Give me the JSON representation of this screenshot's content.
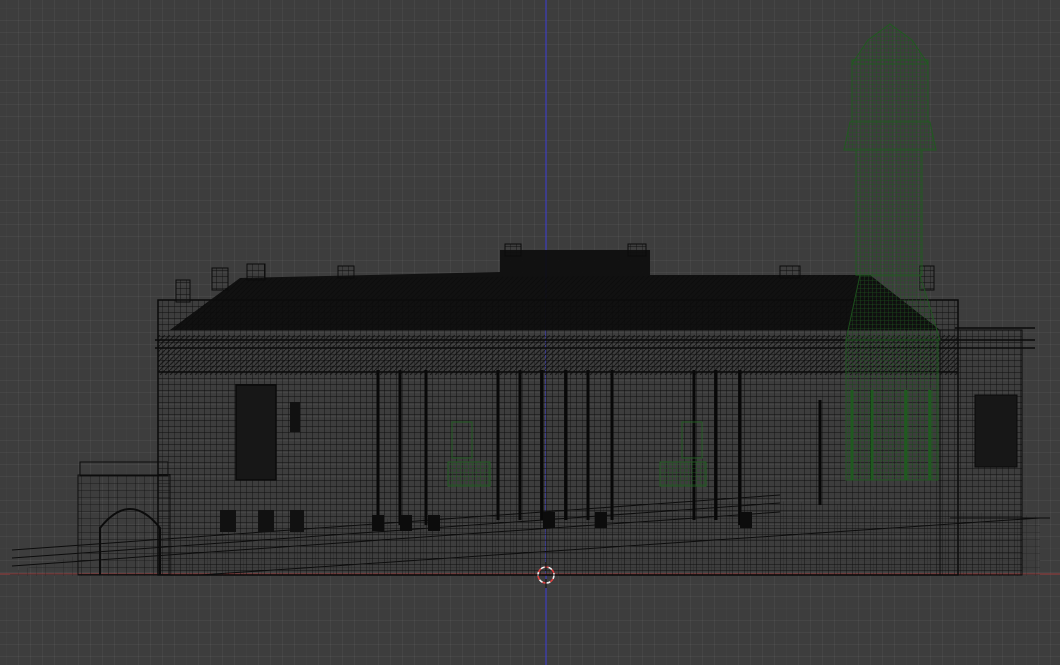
{
  "viewport": {
    "view": "orthographic-front",
    "display_mode": "wireframe",
    "grid_visible": true
  },
  "colors": {
    "background": "#3d3d3d",
    "wire": "#0b0b0b",
    "selected_wire": "#1f5a1f",
    "z_axis": "#3b3bd6",
    "x_axis": "#b23a3a",
    "cursor_red": "#e04040",
    "cursor_white": "#f0f0f0"
  },
  "objects": [
    {
      "name": "building-wireframe",
      "selected": false
    },
    {
      "name": "tower-wireframe",
      "selected": true
    }
  ],
  "icons": [
    "3d-cursor-icon"
  ]
}
